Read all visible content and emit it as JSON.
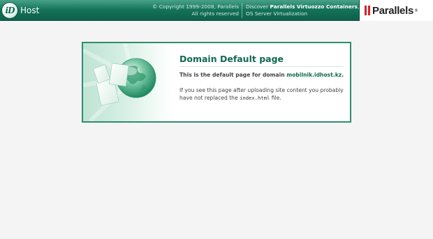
{
  "header": {
    "logo_mark": "iD",
    "logo_text": "Host",
    "copyright_line1": "© Copyright 1999-2008, Parallels",
    "copyright_line2": "All rights reserved",
    "discover_prefix": "Discover ",
    "discover_product": "Parallels Virtuozzo Containers",
    "discover_suffix": ",",
    "discover_line2": "OS Server Virtualization",
    "brand": "Parallels",
    "brand_reg": "®",
    "colors": {
      "header_green": "#137057",
      "brand_red": "#d91f26"
    }
  },
  "panel": {
    "title": "Domain Default page",
    "intro_prefix": "This is the default page for domain ",
    "domain": "mobilnik.idhost.kz",
    "intro_suffix": ".",
    "para_prefix": "If you see this page after uploading site content you probably have not replaced the ",
    "file": "index.html",
    "para_suffix": " file.",
    "illustration": "globe-with-documents-icon"
  }
}
